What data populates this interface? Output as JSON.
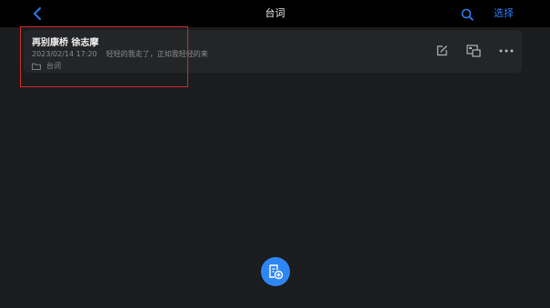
{
  "topbar": {
    "title": "台词",
    "select_label": "选择"
  },
  "note": {
    "title": "再别康桥 徐志摩",
    "date": "2023/02/14 17:20",
    "snippet": "轻轻的我走了，正如我轻轻的来",
    "folder": "台词"
  },
  "icons": {
    "back": "chevron-left-icon",
    "search": "search-icon",
    "edit": "edit-icon",
    "move": "move-to-folder-icon",
    "more": "more-icon",
    "folder": "folder-icon",
    "new_note": "new-note-icon"
  },
  "colors": {
    "accent": "#2e7bf0",
    "background": "#1b1c1e",
    "card": "#242527",
    "highlight": "#d32a2a"
  }
}
